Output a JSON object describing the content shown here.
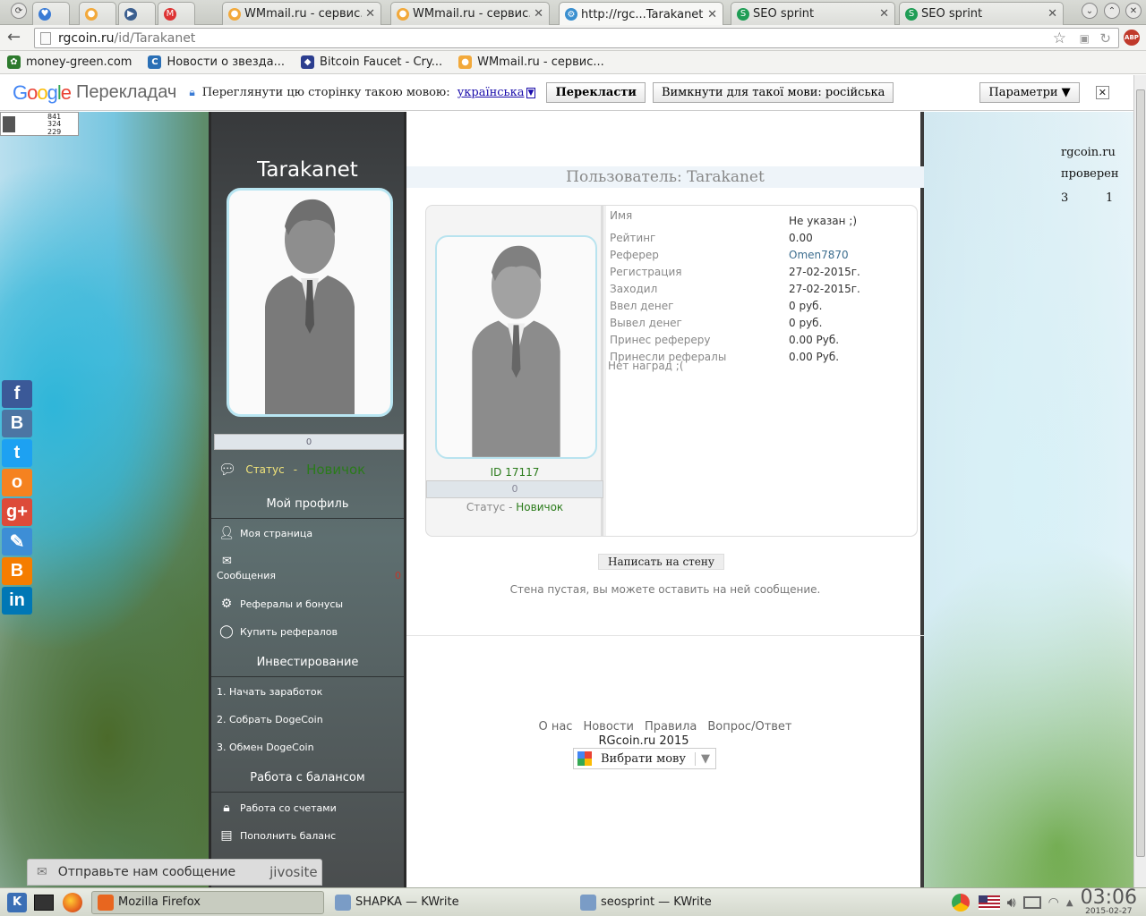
{
  "browser": {
    "tabs": [
      {
        "title": "",
        "fav": "#3a7bd5",
        "glyph": "♥"
      },
      {
        "title": "",
        "fav": "#f2a93b",
        "glyph": "●"
      },
      {
        "title": "",
        "fav": "#3b5f8f",
        "glyph": "▶"
      },
      {
        "title": "",
        "fav": "#d33",
        "glyph": "M"
      },
      {
        "title": "WMmail.ru - сервис...",
        "fav": "#f2a93b",
        "glyph": "●"
      },
      {
        "title": "WMmail.ru - сервис...",
        "fav": "#f2a93b",
        "glyph": "●"
      },
      {
        "title": "http://rgc...Tarakanet",
        "fav": "#3a8fcf",
        "glyph": "⚙"
      },
      {
        "title": "SEO sprint",
        "fav": "#1f9d55",
        "glyph": "S"
      },
      {
        "title": "SEO sprint",
        "fav": "#1f9d55",
        "glyph": "S"
      }
    ],
    "address": {
      "host": "rgcoin.ru",
      "path": "/id/Tarakanet"
    },
    "bookmarks": [
      {
        "label": "money-green.com",
        "color": "#2d7a2d",
        "glyph": "✿"
      },
      {
        "label": "Новости о звезда...",
        "color": "#2a6fb5",
        "glyph": "C"
      },
      {
        "label": "Bitcoin Faucet - Cry...",
        "color": "#2c3e8f",
        "glyph": "◆"
      },
      {
        "label": "WMmail.ru - сервис...",
        "color": "#f2a93b",
        "glyph": "●"
      }
    ]
  },
  "translate": {
    "logo_g": "Google",
    "logo_t": "Перекладач",
    "prompt": "Переглянути цю сторінку такою мовою:",
    "language": "українська",
    "translate_btn": "Перекласти",
    "never_btn": "Вимкнути для такої мови: російська",
    "options_btn": "Параметри ▼",
    "close": "✕"
  },
  "counter": {
    "l1": "841",
    "l2": "324",
    "l3": "229"
  },
  "social": [
    {
      "glyph": "f",
      "color": "#3b5998",
      "name": "facebook"
    },
    {
      "glyph": "B",
      "color": "#4c75a3",
      "name": "vkontakte"
    },
    {
      "glyph": "t",
      "color": "#1da1f2",
      "name": "twitter"
    },
    {
      "glyph": "o",
      "color": "#f58220",
      "name": "odnoklassniki"
    },
    {
      "glyph": "g+",
      "color": "#dd4b39",
      "name": "google-plus"
    },
    {
      "glyph": "✎",
      "color": "#3d8ed6",
      "name": "livejournal"
    },
    {
      "glyph": "B",
      "color": "#f57d00",
      "name": "blogger"
    },
    {
      "glyph": "in",
      "color": "#0077b5",
      "name": "linkedin"
    }
  ],
  "sidebar": {
    "username": "Tarakanet",
    "progress": "0",
    "status_label": "Статус",
    "status_sep": "-",
    "status_value": "Новичок",
    "sections": {
      "profile": "Мой профиль",
      "invest": "Инвестирование",
      "balance": "Работа с балансом"
    },
    "items": {
      "my_page": "Моя страница",
      "messages": "Сообщения",
      "messages_count": "0",
      "referrals": "Рефералы и бонусы",
      "buy_refs": "Купить рефералов",
      "start": "1. Начать заработок",
      "collect": "2. Собрать DogeCoin",
      "exchange": "3. Обмен DogeCoin",
      "accounts": "Работа со счетами",
      "topup": "Пополнить баланс"
    }
  },
  "profile": {
    "title": "Пользователь: Tarakanet",
    "id": "ID 17117",
    "progress": "0",
    "status_label": "Статус",
    "status_sep": "-",
    "status_value": "Новичок",
    "fields": [
      {
        "label": "Имя",
        "value": "Не указан ;)"
      },
      {
        "label": "Рейтинг",
        "value": "0.00"
      },
      {
        "label": "Реферер",
        "value": "Omen7870"
      },
      {
        "label": "Регистрация",
        "value": "27-02-2015г."
      },
      {
        "label": "Заходил",
        "value": "27-02-2015г."
      },
      {
        "label": "Ввел денег",
        "value": "0 руб."
      },
      {
        "label": "Вывел денег",
        "value": "0 руб."
      },
      {
        "label": "Принес рефереру",
        "value": "0.00 Руб."
      },
      {
        "label": "Принесли рефералы",
        "value": "0.00 Руб."
      }
    ],
    "no_awards": "Нет наград ;(",
    "wall_button": "Написать на стену",
    "wall_empty": "Стена пустая, вы можете оставить на ней сообщение."
  },
  "footer": {
    "links": [
      "О нас",
      "Новости",
      "Правила",
      "Вопрос/Ответ"
    ],
    "copyright": "RGcoin.ru 2015",
    "lang_btn": "Вибрати мову"
  },
  "right": {
    "site": "rgcoin.ru",
    "checked": "проверен",
    "n1": "3",
    "n2": "1"
  },
  "jivo": {
    "text": "Отправьте нам сообщение",
    "brand": "jivosite"
  },
  "taskbar": {
    "tasks": [
      {
        "label": "Mozilla Firefox",
        "color": "#e8661f"
      },
      {
        "label": "SHAPKA — KWrite",
        "color": "#7a9cc6"
      },
      {
        "label": "seosprint — KWrite",
        "color": "#7a9cc6"
      }
    ],
    "time": "03:06",
    "date": "2015-02-27"
  }
}
